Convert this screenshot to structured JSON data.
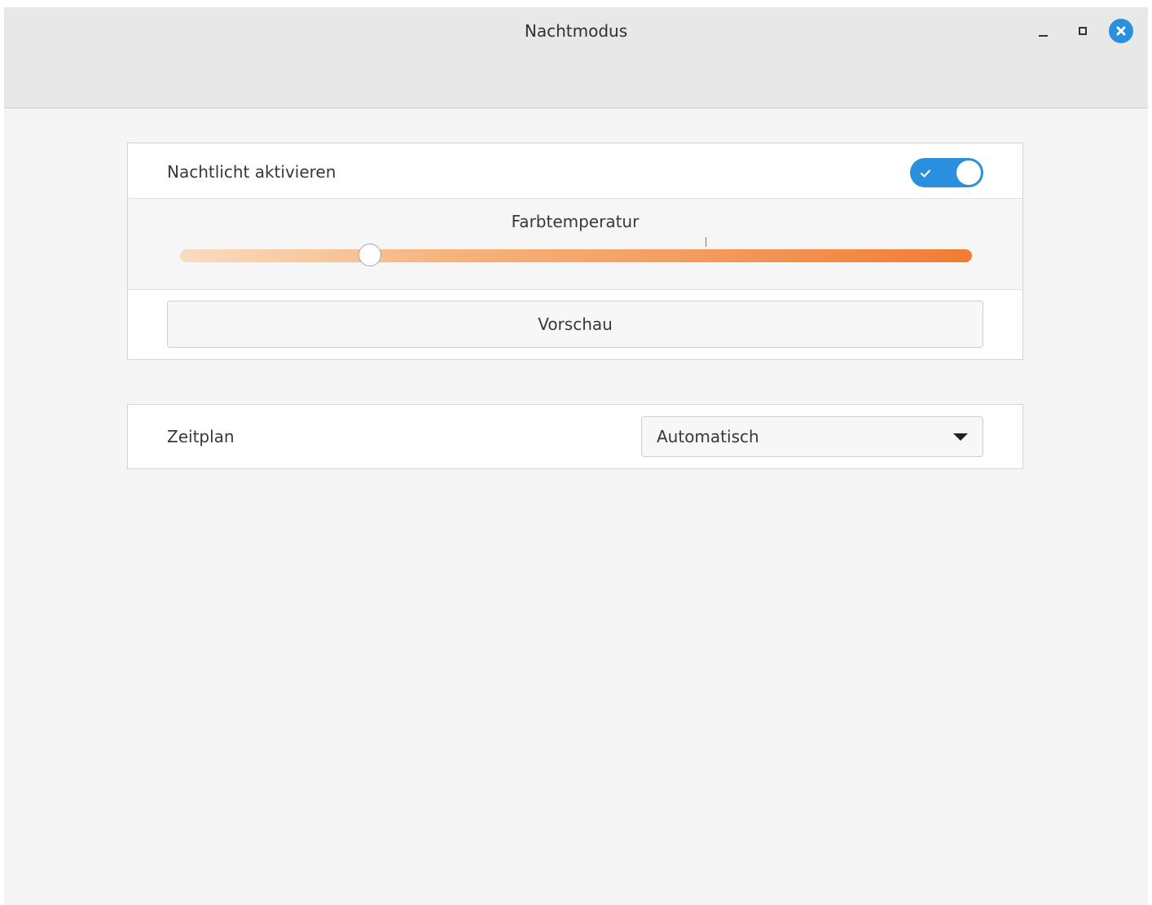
{
  "window": {
    "title": "Nachtmodus"
  },
  "night_light": {
    "label": "Nachtlicht aktivieren",
    "enabled": true
  },
  "color_temperature": {
    "label": "Farbtemperatur",
    "level": 0.24,
    "track_colors": [
      "#f9dcc0",
      "#f27c34"
    ]
  },
  "preview_button": {
    "label": "Vorschau"
  },
  "schedule": {
    "label": "Zeitplan",
    "selected": "Automatisch"
  },
  "colors": {
    "accent": "#2b8fe0"
  },
  "icons": {
    "minimize": "minimize-icon",
    "maximize": "maximize-icon",
    "close": "close-icon",
    "check": "check-icon",
    "dropdown": "chevron-down-icon"
  }
}
